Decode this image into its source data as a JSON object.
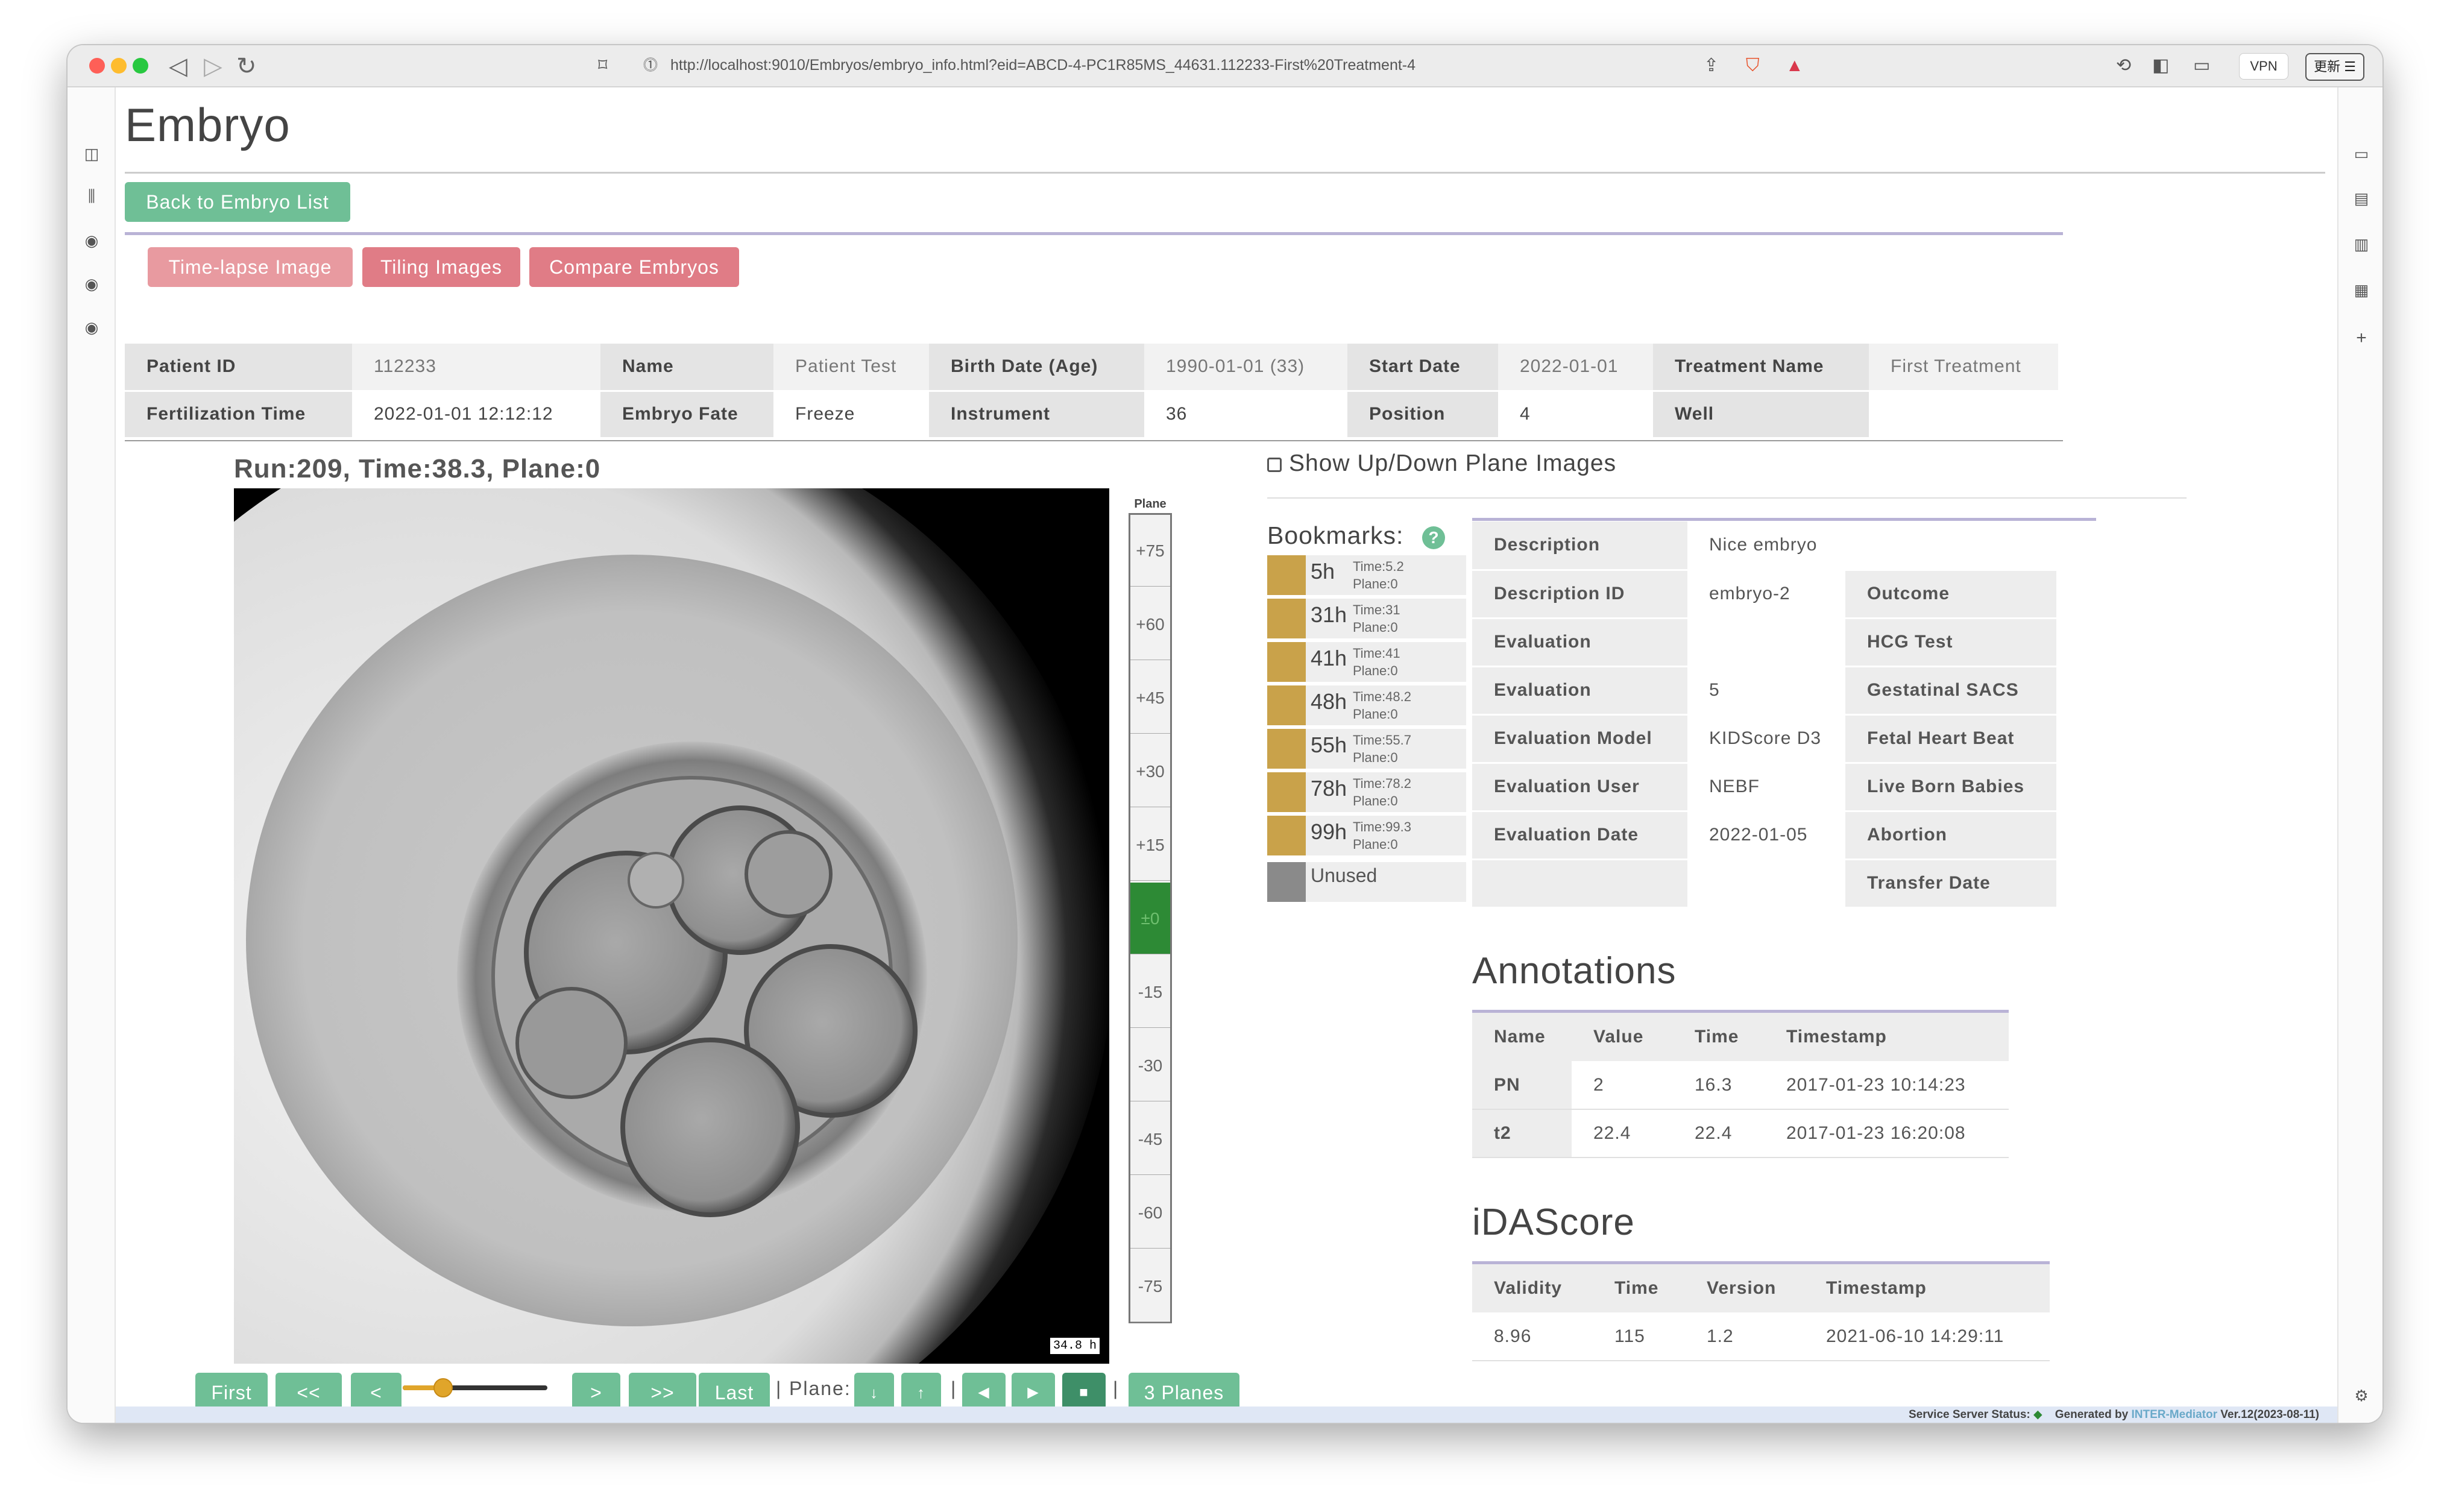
{
  "browser": {
    "url": "http://localhost:9010/Embryos/embryo_info.html?eid=ABCD-4-PC1R85MS_44631.112233-First%20Treatment-4",
    "vpn_label": "VPN",
    "update_label": "更新"
  },
  "page": {
    "title": "Embryo",
    "back_label": "Back to Embryo List",
    "tabs": [
      "Time-lapse Image",
      "Tiling Images",
      "Compare Embryos"
    ]
  },
  "patient": {
    "rows": [
      [
        {
          "k": "Patient ID",
          "v": "112233"
        },
        {
          "k": "Name",
          "v": "Patient Test"
        },
        {
          "k": "Birth Date (Age)",
          "v": "1990-01-01 (33)"
        },
        {
          "k": "Start Date",
          "v": "2022-01-01"
        },
        {
          "k": "Treatment Name",
          "v": "First Treatment"
        }
      ],
      [
        {
          "k": "Fertilization Time",
          "v": "2022-01-01 12:12:12"
        },
        {
          "k": "Embryo Fate",
          "v": "Freeze"
        },
        {
          "k": "Instrument",
          "v": "36"
        },
        {
          "k": "Position",
          "v": "4"
        },
        {
          "k": "Well",
          "v": ""
        }
      ]
    ]
  },
  "viewer": {
    "run_label": "Run:209, Time:38.3, Plane:0",
    "image_stamp": "34.8 h",
    "plane_header": "Plane",
    "planes": [
      "+75",
      "+60",
      "+45",
      "+30",
      "+15",
      "±0",
      "-15",
      "-30",
      "-45",
      "-60",
      "-75"
    ],
    "active_plane": "±0",
    "time_slider_value": 0.27
  },
  "show_updown_label": "Show Up/Down Plane Images",
  "bookmarks": {
    "title": "Bookmarks:",
    "help": "?",
    "items": [
      {
        "hours": "5h",
        "time": "Time:5.2",
        "plane": "Plane:0"
      },
      {
        "hours": "31h",
        "time": "Time:31",
        "plane": "Plane:0"
      },
      {
        "hours": "41h",
        "time": "Time:41",
        "plane": "Plane:0"
      },
      {
        "hours": "48h",
        "time": "Time:48.2",
        "plane": "Plane:0"
      },
      {
        "hours": "55h",
        "time": "Time:55.7",
        "plane": "Plane:0"
      },
      {
        "hours": "78h",
        "time": "Time:78.2",
        "plane": "Plane:0"
      },
      {
        "hours": "99h",
        "time": "Time:99.3",
        "plane": "Plane:0"
      }
    ],
    "unused_label": "Unused",
    "bookmark_color": "#c9a24a",
    "unused_color": "#8a8a8a"
  },
  "details": {
    "rows": [
      {
        "k1": "Description",
        "v1": "Nice embryo",
        "k2": "",
        "v2": ""
      },
      {
        "k1": "Description ID",
        "v1": "embryo-2",
        "k2": "Outcome",
        "v2": ""
      },
      {
        "k1": "Evaluation",
        "v1": "",
        "k2": "HCG Test",
        "v2": ""
      },
      {
        "k1": "Evaluation",
        "v1": "5",
        "k2": "Gestatinal SACS",
        "v2": ""
      },
      {
        "k1": "Evaluation Model",
        "v1": "KIDScore D3",
        "k2": "Fetal Heart Beat",
        "v2": ""
      },
      {
        "k1": "Evaluation User",
        "v1": "NEBF",
        "k2": "Live Born Babies",
        "v2": ""
      },
      {
        "k1": "Evaluation Date",
        "v1": "2022-01-05",
        "k2": "Abortion",
        "v2": ""
      },
      {
        "k1": "",
        "v1": "",
        "k2": "Transfer Date",
        "v2": ""
      }
    ]
  },
  "annotations": {
    "title": "Annotations",
    "headers": [
      "Name",
      "Value",
      "Time",
      "Timestamp"
    ],
    "rows": [
      [
        "PN",
        "2",
        "16.3",
        "2017-01-23 10:14:23"
      ],
      [
        "t2",
        "22.4",
        "22.4",
        "2017-01-23 16:20:08"
      ]
    ]
  },
  "idascore": {
    "title": "iDAScore",
    "headers": [
      "Validity",
      "Time",
      "Version",
      "Timestamp"
    ],
    "rows": [
      [
        "8.96",
        "115",
        "1.2",
        "2021-06-10 14:29:11"
      ]
    ]
  },
  "controls": {
    "first": "First",
    "prev_fast": "<<",
    "prev": "<",
    "next": ">",
    "next_fast": ">>",
    "last": "Last",
    "sep1": "|",
    "plane_label": "Plane:",
    "plane_down": "↓",
    "plane_up": "↑",
    "sep2": "|",
    "play_back": "◀",
    "play_fwd": "▶",
    "stop": "■",
    "sep3": "|",
    "three_planes": "3 Planes"
  },
  "footer": {
    "status_label": "Service Server Status:",
    "generated_by": "Generated by",
    "intermediator": "INTER-Mediator",
    "version": "Ver.12(2023-08-11)"
  },
  "colors": {
    "accent_green": "#6fbf96",
    "tab_pink": "#e89aa0",
    "plane_active": "#2d8a35",
    "divider_purple": "#b9b3d6"
  }
}
